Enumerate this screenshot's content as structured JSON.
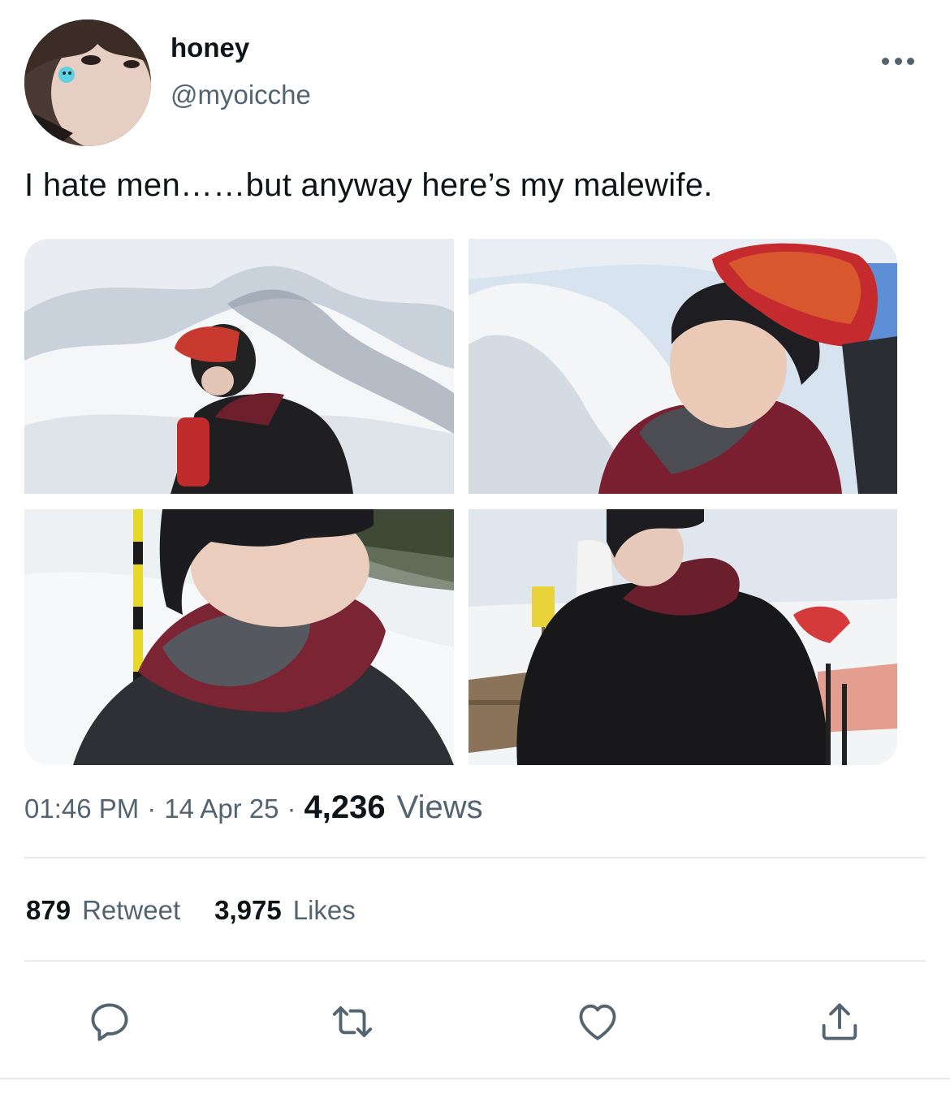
{
  "user": {
    "display_name": "honey",
    "handle": "@myoicche"
  },
  "tweet": {
    "text": "I hate men……but anyway here’s my malewife."
  },
  "media": {
    "photos": [
      {
        "alt": ""
      },
      {
        "alt": ""
      },
      {
        "alt": ""
      },
      {
        "alt": ""
      }
    ]
  },
  "meta": {
    "time": "01:46 PM",
    "separator": "·",
    "date": "14 Apr 25",
    "views_count": "4,236",
    "views_label": "Views"
  },
  "stats": {
    "retweets_count": "879",
    "retweets_label": "Retweet",
    "likes_count": "3,975",
    "likes_label": "Likes"
  },
  "icons": {
    "more": "more-horizontal-icon",
    "reply": "reply-icon",
    "retweet": "retweet-icon",
    "like": "heart-icon",
    "share": "share-icon"
  },
  "colors": {
    "text_primary": "#0f1419",
    "text_secondary": "#536471",
    "divider": "#e7e9ea"
  }
}
